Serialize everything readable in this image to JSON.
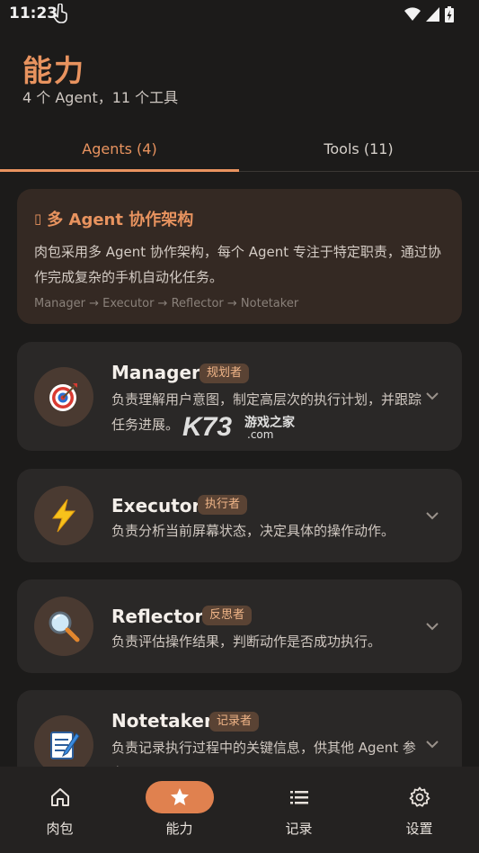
{
  "status_bar": {
    "time": "11:23",
    "icons": [
      "touch-gesture-icon",
      "wifi-icon",
      "signal-icon",
      "battery-charging-icon"
    ]
  },
  "header": {
    "title": "能力",
    "subtitle": "4 个 Agent，11 个工具"
  },
  "tabs": [
    {
      "label": "Agents (4)",
      "active": true
    },
    {
      "label": "Tools (11)",
      "active": false
    }
  ],
  "intro": {
    "title": "多 Agent 协作架构",
    "description": "肉包采用多 Agent 协作架构，每个 Agent 专注于特定职责，通过协作完成复杂的手机自动化任务。",
    "flow": "Manager → Executor → Reflector → Notetaker"
  },
  "agents": [
    {
      "name": "Manager",
      "role": "规划者",
      "description": "负责理解用户意图，制定高层次的执行计划，并跟踪任务进展。",
      "icon": "target-icon"
    },
    {
      "name": "Executor",
      "role": "执行者",
      "description": "负责分析当前屏幕状态，决定具体的操作动作。",
      "icon": "lightning-icon"
    },
    {
      "name": "Reflector",
      "role": "反思者",
      "description": "负责评估操作结果，判断动作是否成功执行。",
      "icon": "magnifier-icon"
    },
    {
      "name": "Notetaker",
      "role": "记录者",
      "description": "负责记录执行过程中的关键信息，供其他 Agent 参考。",
      "icon": "notepad-icon"
    }
  ],
  "watermark": {
    "brand": "K73",
    "name": "游戏之家",
    "domain": ".com"
  },
  "bottom_nav": [
    {
      "label": "肉包",
      "icon": "home-icon",
      "active": false
    },
    {
      "label": "能力",
      "icon": "star-icon",
      "active": true
    },
    {
      "label": "记录",
      "icon": "list-icon",
      "active": false
    },
    {
      "label": "设置",
      "icon": "settings-gear-icon",
      "active": false
    }
  ],
  "colors": {
    "accent": "#e8935f",
    "background": "#1c1b1a",
    "card": "#2a2827",
    "badge": "#5a4334"
  }
}
